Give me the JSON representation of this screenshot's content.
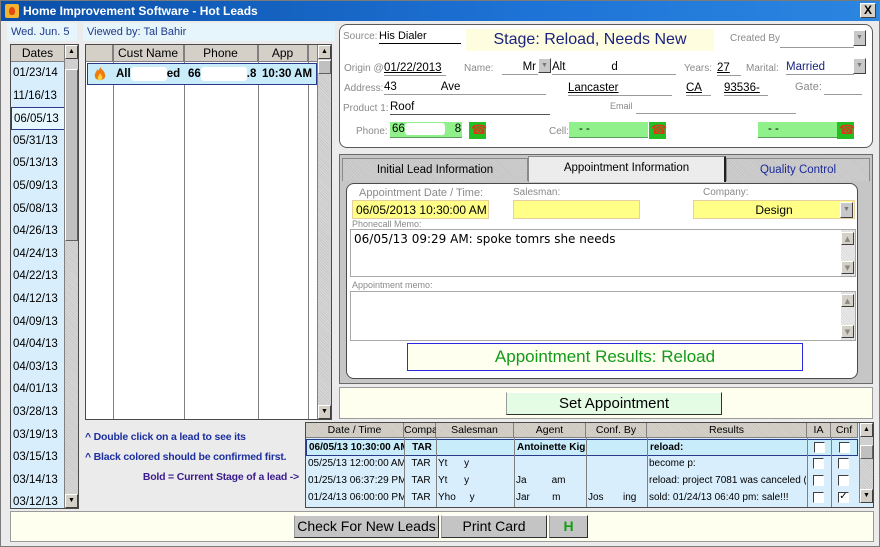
{
  "window": {
    "title": "Home Improvement Software - Hot Leads",
    "close_label": "X"
  },
  "header": {
    "today": "Wed. Jun. 5",
    "viewed_by": "Viewed by: Tal Bahir"
  },
  "dates": {
    "header": "Dates",
    "items": [
      "01/23/14",
      "11/16/13",
      "06/05/13",
      "05/31/13",
      "05/13/13",
      "05/09/13",
      "05/08/13",
      "04/26/13",
      "04/24/13",
      "04/22/13",
      "04/12/13",
      "04/09/13",
      "04/04/13",
      "04/03/13",
      "04/01/13",
      "03/28/13",
      "03/19/13",
      "03/15/13",
      "03/14/13",
      "03/12/13"
    ],
    "selected": "06/05/13"
  },
  "leads": {
    "columns": [
      "Cust Name",
      "Phone",
      "App Date"
    ],
    "rows": [
      {
        "icon": "flame-icon",
        "name_start": "All",
        "name_end": "ed",
        "phone_start": "66",
        "phone_end": ".8",
        "app_date": "10:30 AM"
      }
    ]
  },
  "notes": {
    "line1": "^ Double click on a lead to see its",
    "line2": "^ Black colored should be confirmed first.",
    "line3": "Bold = Current Stage of a lead  ->"
  },
  "lead_card": {
    "source_label": "Source:",
    "source": "His Dialer",
    "stage": "Stage: Reload, Needs New",
    "created_by_label": "Created By",
    "created_by": "",
    "origin_label": "Origin @",
    "origin": "01/22/2013",
    "name_label": "Name:",
    "title": "Mr",
    "first_name": "Alt",
    "last_name": "d",
    "years_label": "Years:",
    "years": "27",
    "marital_label": "Marital:",
    "marital": "Married",
    "address_label": "Address:",
    "address_num": "43",
    "address_street": "Ave",
    "city": "Lancaster",
    "state": "CA",
    "zip": "93536-",
    "gate_label": "Gate:",
    "gate": "",
    "product_label": "Product 1:",
    "product": "Roof",
    "email_label": "Email",
    "email": "",
    "phone_label": "Phone:",
    "phone_start": "66",
    "phone_end": "8",
    "cell_label": "Cell:",
    "cell": "-  -",
    "phone3": "-  -"
  },
  "tabs": [
    {
      "label": "Initial Lead Information",
      "active": false
    },
    {
      "label": "Appointment Information",
      "active": true
    },
    {
      "label": "Quality Control",
      "active": false
    }
  ],
  "appointment": {
    "date_label": "Appointment Date / Time:",
    "date": "06/05/2013 10:30:00 AM",
    "salesman_label": "Salesman:",
    "salesman": "",
    "company_label": "Company:",
    "company": "Design",
    "phonecall_memo_label": "Phonecall Memo:",
    "phonecall_memo": "06/05/13 09:29 AM: spoke tomrs she needs",
    "appt_memo_label": "Appointment memo:",
    "appt_memo": "",
    "results": "Appointment Results: Reload"
  },
  "set_appointment_label": "Set Appointment",
  "history": {
    "columns": [
      "Date / Time",
      "Compa",
      "Salesman",
      "Agent",
      "Conf. By",
      "Results",
      "IA",
      "Cnf"
    ],
    "rows": [
      {
        "datetime": "06/05/13 10:30:00 AM",
        "company": "TAR",
        "salesman": "",
        "agent": "Antoinette Kig",
        "conf_by": "",
        "results": "reload:",
        "ia": false,
        "cnf": false,
        "current": true
      },
      {
        "datetime": "05/25/13 12:00:00 AM",
        "company": "TAR",
        "salesman": "Yt      y",
        "agent": "",
        "conf_by": "",
        "results": "become p:",
        "ia": false,
        "cnf": false,
        "current": false
      },
      {
        "datetime": "01/25/13 06:37:29 PM",
        "company": "TAR",
        "salesman": "Yt      y",
        "agent": "Ja         am",
        "conf_by": "",
        "results": "reload: project 7081 was canceled (",
        "ia": false,
        "cnf": false,
        "current": false
      },
      {
        "datetime": "01/24/13 06:00:00 PM",
        "company": "TAR",
        "salesman": "Yho     y",
        "agent": "Jar        m",
        "conf_by": "Jos       ing",
        "results": "sold: 01/24/13 06:40 pm: sale!!!",
        "ia": false,
        "cnf": true,
        "current": false
      }
    ]
  },
  "bottom": {
    "check_leads": "Check For New Leads",
    "print_card": "Print Card",
    "h_label": "H"
  },
  "colors": {
    "title_bar": "#1e73d6",
    "stage_text": "#1a237e",
    "results_text": "#129a1a",
    "phone_green": "#90f08a",
    "highlight_yellow": "#ffff88",
    "selection": "#c8ecfa"
  }
}
